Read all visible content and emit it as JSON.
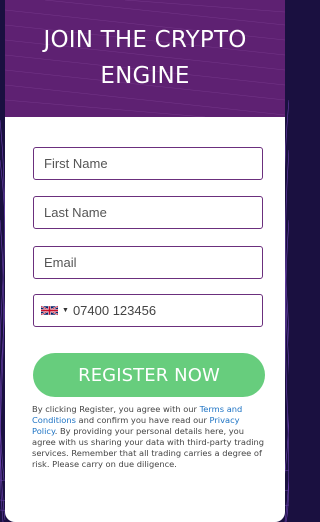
{
  "header": {
    "title_line1": "JOIN THE CRYPTO",
    "title_line2": "ENGINE"
  },
  "form": {
    "first_name": {
      "placeholder": "First Name",
      "value": ""
    },
    "last_name": {
      "placeholder": "Last Name",
      "value": ""
    },
    "email": {
      "placeholder": "Email",
      "value": ""
    },
    "phone": {
      "country_flag": "uk-flag-icon",
      "placeholder": "07400 123456",
      "value": ""
    },
    "register_label": "REGISTER NOW"
  },
  "disclaimer": {
    "part1": "By clicking Register, you agree with our ",
    "terms_link": "Terms and Conditions",
    "part2": " and confirm you have read our ",
    "privacy_link": "Privacy Policy",
    "part3": ". By providing your personal details here, you agree with us sharing your data with third-party trading services. Remember that all trading carries a degree of risk. Please carry on due diligence."
  },
  "colors": {
    "header_bg": "#5e2172",
    "field_border": "#6b2f7d",
    "button_bg": "#67cd7d",
    "link": "#1d73c4",
    "page_bg": "#1a1040"
  }
}
